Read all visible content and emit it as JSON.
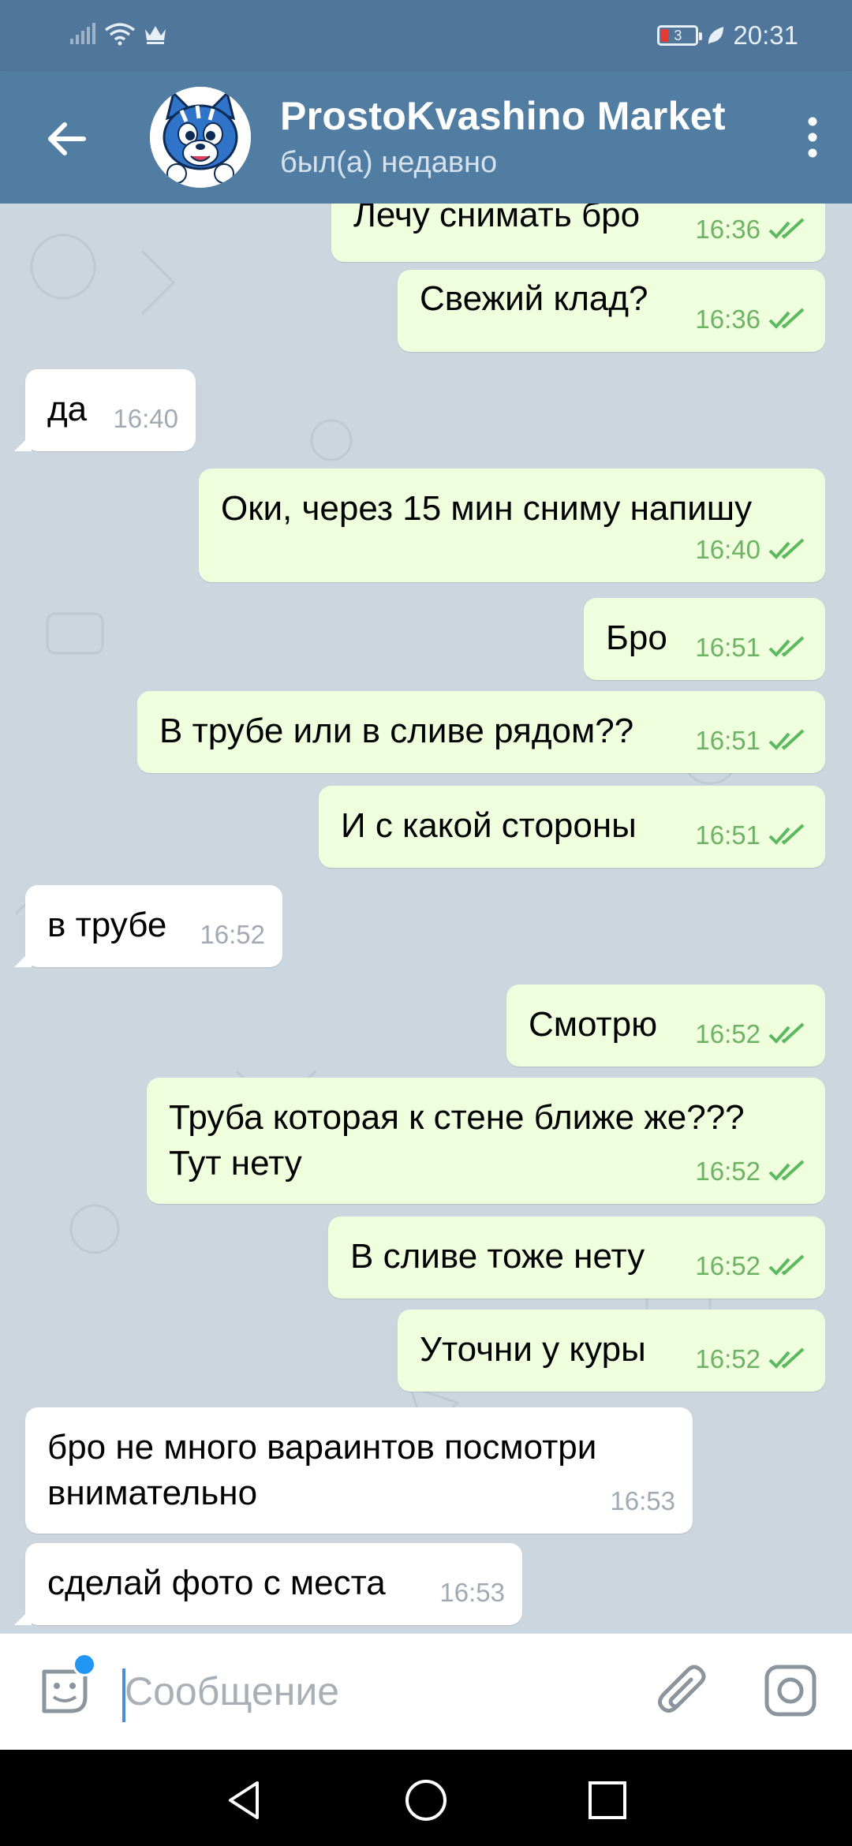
{
  "status_bar": {
    "time": "20:31",
    "battery_level": "3",
    "icons": [
      "signal-icon",
      "wifi-icon",
      "crown-icon",
      "battery-icon",
      "leaf-icon"
    ]
  },
  "header": {
    "title": "ProstoKvashino Market",
    "subtitle": "был(а) недавно"
  },
  "messages": [
    {
      "dir": "out",
      "text": "Лечу снимать бро",
      "time": "16:36"
    },
    {
      "dir": "out",
      "text": "Свежий клад?",
      "time": "16:36"
    },
    {
      "dir": "in",
      "text": "да",
      "time": "16:40"
    },
    {
      "dir": "out",
      "text": "Оки, через 15 мин сниму напишу",
      "time": "16:40"
    },
    {
      "dir": "out",
      "text": "Бро",
      "time": "16:51"
    },
    {
      "dir": "out",
      "text": "В трубе или в сливе рядом??",
      "time": "16:51"
    },
    {
      "dir": "out",
      "text": "И с какой стороны",
      "time": "16:51"
    },
    {
      "dir": "in",
      "text": "в трубе",
      "time": "16:52"
    },
    {
      "dir": "out",
      "text": "Смотрю",
      "time": "16:52"
    },
    {
      "dir": "out",
      "text": "Труба которая к стене ближе же???",
      "text2": "Тут нету",
      "time": "16:52"
    },
    {
      "dir": "out",
      "text": "В сливе тоже нету",
      "time": "16:52"
    },
    {
      "dir": "out",
      "text": "Уточни у куры",
      "time": "16:52"
    },
    {
      "dir": "in",
      "text": "бро не много вараинтов посмотри",
      "text2": "внимательно",
      "time": "16:53"
    },
    {
      "dir": "in",
      "text": "сделай фото с места",
      "time": "16:53"
    }
  ],
  "input": {
    "placeholder": "Сообщение"
  },
  "colors": {
    "header": "#517da2",
    "status_bar": "#51769c",
    "outgoing_bubble": "#effedd",
    "incoming_bubble": "#ffffff",
    "outgoing_time": "#6eb365",
    "chat_background": "#cbd6de"
  }
}
